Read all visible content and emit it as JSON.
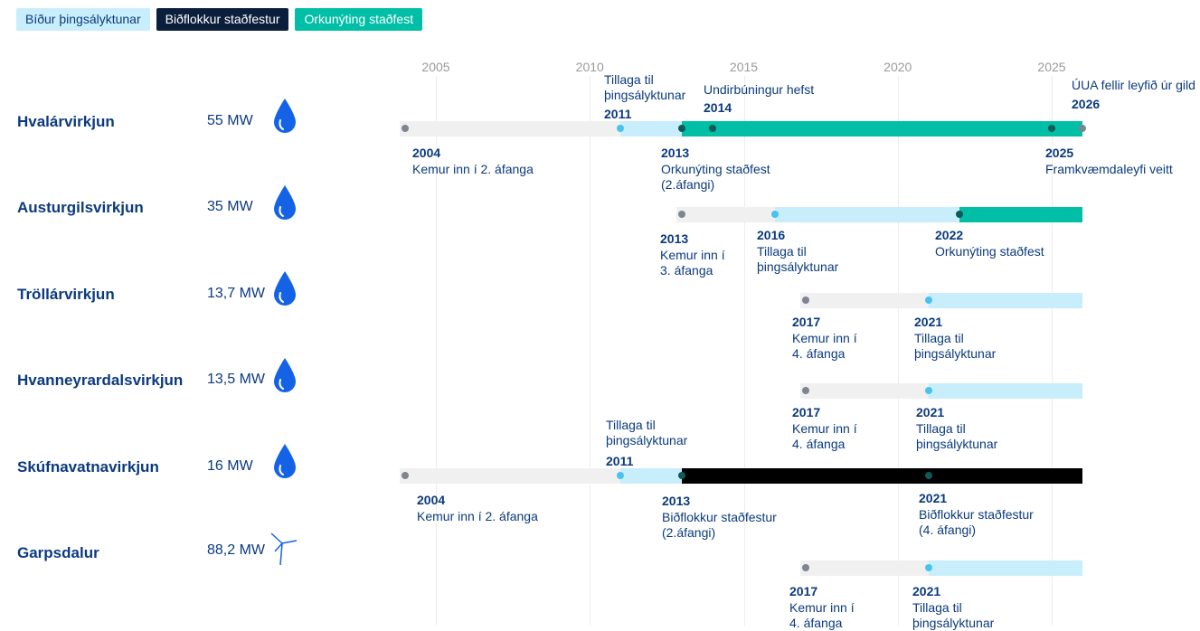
{
  "legend": {
    "pending": "Bíður þingsályktunar",
    "reserve": "Biðflokkur staðfestur",
    "energy": "Orkunýting staðfest"
  },
  "colors": {
    "pending": "#c8eefb",
    "reserve": "#000000",
    "energy": "#00bfa6",
    "early": "#f0f0f0",
    "text": "#0b3a7e"
  },
  "chart_data": {
    "type": "timeline",
    "x_ticks": [
      "2005",
      "2010",
      "2015",
      "2020",
      "2025"
    ],
    "xlim": [
      2004,
      2026.3
    ],
    "projects": [
      {
        "name": "Hvalárvirkjun",
        "capacity": "55 MW",
        "icon": "water-drop-icon",
        "segments": [
          {
            "status": "early",
            "from": 2004.0,
            "to": 2011.0
          },
          {
            "status": "pending",
            "from": 2011.0,
            "to": 2013.0
          },
          {
            "status": "energy",
            "from": 2013.0,
            "to": 2026.0
          }
        ],
        "events": [
          {
            "year": "2004",
            "text": "Kemur inn í 2. áfanga"
          },
          {
            "year": "2011",
            "text": "Tillaga til\nþingsályktunar"
          },
          {
            "year": "2013",
            "text": "Orkunýting staðfest\n(2.áfangi)"
          },
          {
            "year": "2014",
            "text": "Undirbúningur hefst"
          },
          {
            "year": "2025",
            "text": "Framkvæmdaleyfi veitt"
          },
          {
            "year": "2026",
            "text": "ÚUA fellir leyfið úr gild"
          }
        ]
      },
      {
        "name": "Austurgilsvirkjun",
        "capacity": "35 MW",
        "icon": "water-drop-icon",
        "segments": [
          {
            "status": "early",
            "from": 2013.0,
            "to": 2016.0
          },
          {
            "status": "pending",
            "from": 2016.0,
            "to": 2022.0
          },
          {
            "status": "energy",
            "from": 2022.0,
            "to": 2026.0
          }
        ],
        "events": [
          {
            "year": "2013",
            "text": "Kemur inn í\n3. áfanga"
          },
          {
            "year": "2016",
            "text": "Tillaga til\nþingsályktunar"
          },
          {
            "year": "2022",
            "text": "Orkunýting staðfest"
          }
        ]
      },
      {
        "name": "Tröllárvirkjun",
        "capacity": "13,7 MW",
        "icon": "water-drop-icon",
        "segments": [
          {
            "status": "early",
            "from": 2017.0,
            "to": 2021.0
          },
          {
            "status": "pending",
            "from": 2021.0,
            "to": 2026.0
          }
        ],
        "events": [
          {
            "year": "2017",
            "text": "Kemur inn í\n4. áfanga"
          },
          {
            "year": "2021",
            "text": "Tillaga til\nþingsályktunar"
          }
        ]
      },
      {
        "name": "Hvanneyrardalsvirkjun",
        "capacity": "13,5 MW",
        "icon": "water-drop-icon",
        "segments": [
          {
            "status": "early",
            "from": 2017.0,
            "to": 2021.0
          },
          {
            "status": "pending",
            "from": 2021.0,
            "to": 2026.0
          }
        ],
        "events": [
          {
            "year": "2017",
            "text": "Kemur inn í\n4. áfanga"
          },
          {
            "year": "2021",
            "text": "Tillaga til\nþingsályktunar"
          }
        ]
      },
      {
        "name": "Skúfnavatnavirkjun",
        "capacity": "16 MW",
        "icon": "water-drop-icon",
        "segments": [
          {
            "status": "early",
            "from": 2004.0,
            "to": 2011.0
          },
          {
            "status": "pending",
            "from": 2011.0,
            "to": 2013.0
          },
          {
            "status": "reserve",
            "from": 2013.0,
            "to": 2026.0
          }
        ],
        "events": [
          {
            "year": "2004",
            "text": "Kemur inn í 2. áfanga"
          },
          {
            "year": "2011",
            "text": "Tillaga til\nþingsályktunar"
          },
          {
            "year": "2013",
            "text": "Biðflokkur staðfestur\n(2.áfangi)"
          },
          {
            "year": "2021",
            "text": "Biðflokkur staðfestur\n(4. áfangi)"
          }
        ]
      },
      {
        "name": "Garpsdalur",
        "capacity": "88,2 MW",
        "icon": "wind-turbine-icon",
        "segments": [
          {
            "status": "early",
            "from": 2017.0,
            "to": 2021.0
          },
          {
            "status": "pending",
            "from": 2021.0,
            "to": 2026.0
          }
        ],
        "events": [
          {
            "year": "2017",
            "text": "Kemur inn í\n4. áfanga"
          },
          {
            "year": "2021",
            "text": "Tillaga til\nþingsályktunar"
          }
        ]
      }
    ]
  }
}
